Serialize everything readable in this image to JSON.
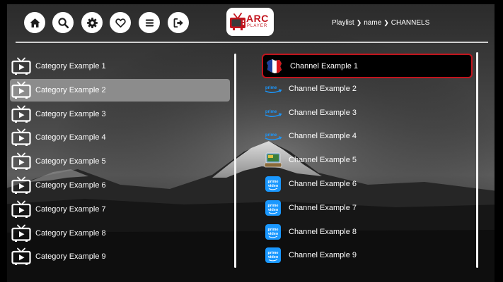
{
  "nav": {
    "buttons": [
      {
        "icon": "home-icon"
      },
      {
        "icon": "search-icon"
      },
      {
        "icon": "gear-icon"
      },
      {
        "icon": "heart-icon"
      },
      {
        "icon": "menu-icon"
      },
      {
        "icon": "logout-icon"
      }
    ]
  },
  "logo": {
    "text": "ARC",
    "subtext": "PLAYER"
  },
  "breadcrumb": {
    "items": [
      "Playlist",
      "name",
      "CHANNELS"
    ]
  },
  "categories": {
    "selected_index": 1,
    "items": [
      {
        "label": "Category Example 1"
      },
      {
        "label": "Category Example 2"
      },
      {
        "label": "Category Example 3"
      },
      {
        "label": "Category Example 4"
      },
      {
        "label": "Category Example 5"
      },
      {
        "label": "Category Example 6"
      },
      {
        "label": "Category Example 7"
      },
      {
        "label": "Category Example 8"
      },
      {
        "label": "Category Example 9"
      }
    ]
  },
  "channels": {
    "selected_index": 0,
    "items": [
      {
        "label": "Channel Example 1",
        "logo": "france-map-logo"
      },
      {
        "label": "Channel Example 2",
        "logo": "prime-wordmark-logo"
      },
      {
        "label": "Channel Example 3",
        "logo": "prime-wordmark-logo"
      },
      {
        "label": "Channel Example 4",
        "logo": "prime-wordmark-logo"
      },
      {
        "label": "Channel Example 5",
        "logo": "tv-stack-logo"
      },
      {
        "label": "Channel Example 6",
        "logo": "prime-video-app-logo"
      },
      {
        "label": "Channel Example 7",
        "logo": "prime-video-app-logo"
      },
      {
        "label": "Channel Example 8",
        "logo": "prime-video-app-logo"
      },
      {
        "label": "Channel Example 9",
        "logo": "prime-video-app-logo"
      }
    ]
  },
  "colors": {
    "accent": "#c2141d",
    "selected_category_bg": "#8c8c8c",
    "divider": "#cfcfcf",
    "prime_blue": "#1a98ff"
  }
}
